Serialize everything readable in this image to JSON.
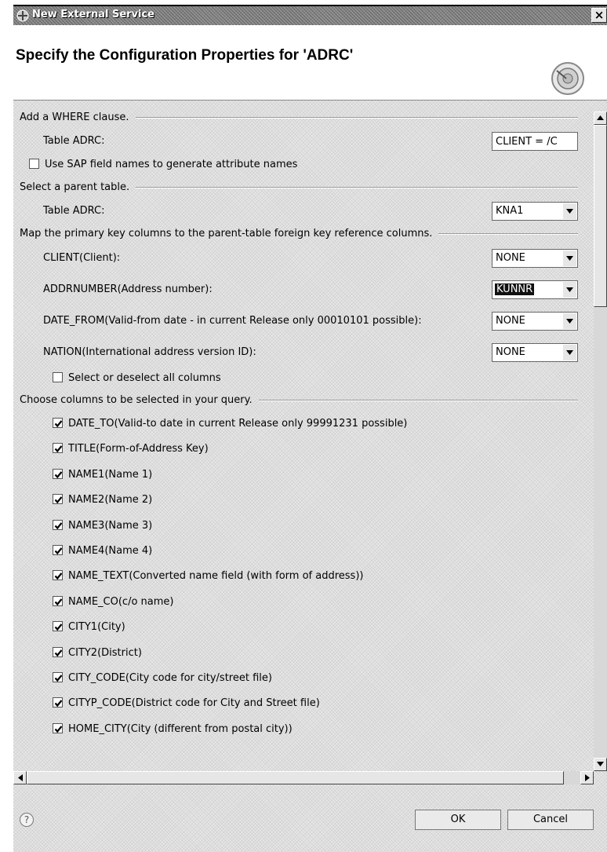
{
  "window": {
    "title": "New External Service"
  },
  "header": {
    "title": "Specify the Configuration Properties for 'ADRC'"
  },
  "where_section": {
    "label": "Add a WHERE clause.",
    "table_label": "Table ADRC:",
    "where_value": "CLIENT = /C"
  },
  "sap_names": {
    "label": "Use SAP field names to generate attribute names",
    "checked": false
  },
  "parent_section": {
    "label": "Select a parent table.",
    "table_label": "Table ADRC:",
    "table_value": "KNA1"
  },
  "map_section": {
    "label": "Map the primary key columns to the parent-table foreign key reference columns.",
    "rows": [
      {
        "label": "CLIENT(Client):",
        "value": "NONE"
      },
      {
        "label": "ADDRNUMBER(Address number):",
        "value": "KUNNR"
      },
      {
        "label": "DATE_FROM(Valid-from date - in current Release only 00010101 possible):",
        "value": "NONE"
      },
      {
        "label": "NATION(International address version ID):",
        "value": "NONE"
      }
    ],
    "select_all_label": "Select or deselect all columns"
  },
  "columns_section": {
    "label": "Choose columns to be selected in your query.",
    "columns": [
      {
        "label": "DATE_TO(Valid-to date in current Release only 99991231 possible)",
        "checked": true
      },
      {
        "label": "TITLE(Form-of-Address Key)",
        "checked": true
      },
      {
        "label": "NAME1(Name 1)",
        "checked": true
      },
      {
        "label": "NAME2(Name 2)",
        "checked": true
      },
      {
        "label": "NAME3(Name 3)",
        "checked": true
      },
      {
        "label": "NAME4(Name 4)",
        "checked": true
      },
      {
        "label": "NAME_TEXT(Converted name field (with form of address))",
        "checked": true
      },
      {
        "label": "NAME_CO(c/o name)",
        "checked": true
      },
      {
        "label": "CITY1(City)",
        "checked": true
      },
      {
        "label": "CITY2(District)",
        "checked": true
      },
      {
        "label": "CITY_CODE(City code for city/street file)",
        "checked": true
      },
      {
        "label": "CITYP_CODE(District code for City and Street file)",
        "checked": true
      },
      {
        "label": "HOME_CITY(City (different from postal city))",
        "checked": true
      }
    ]
  },
  "footer": {
    "help_symbol": "?",
    "ok_label": "OK",
    "cancel_label": "Cancel"
  },
  "icons": {
    "app": "eclipse-app-icon",
    "close": "close-icon",
    "wizard": "wizard-banner-icon",
    "help": "help-icon"
  },
  "colors": {
    "titlebar": "#8a8a8a",
    "dialog_bg": "#e6e6e6",
    "header_bg": "#ffffff"
  }
}
